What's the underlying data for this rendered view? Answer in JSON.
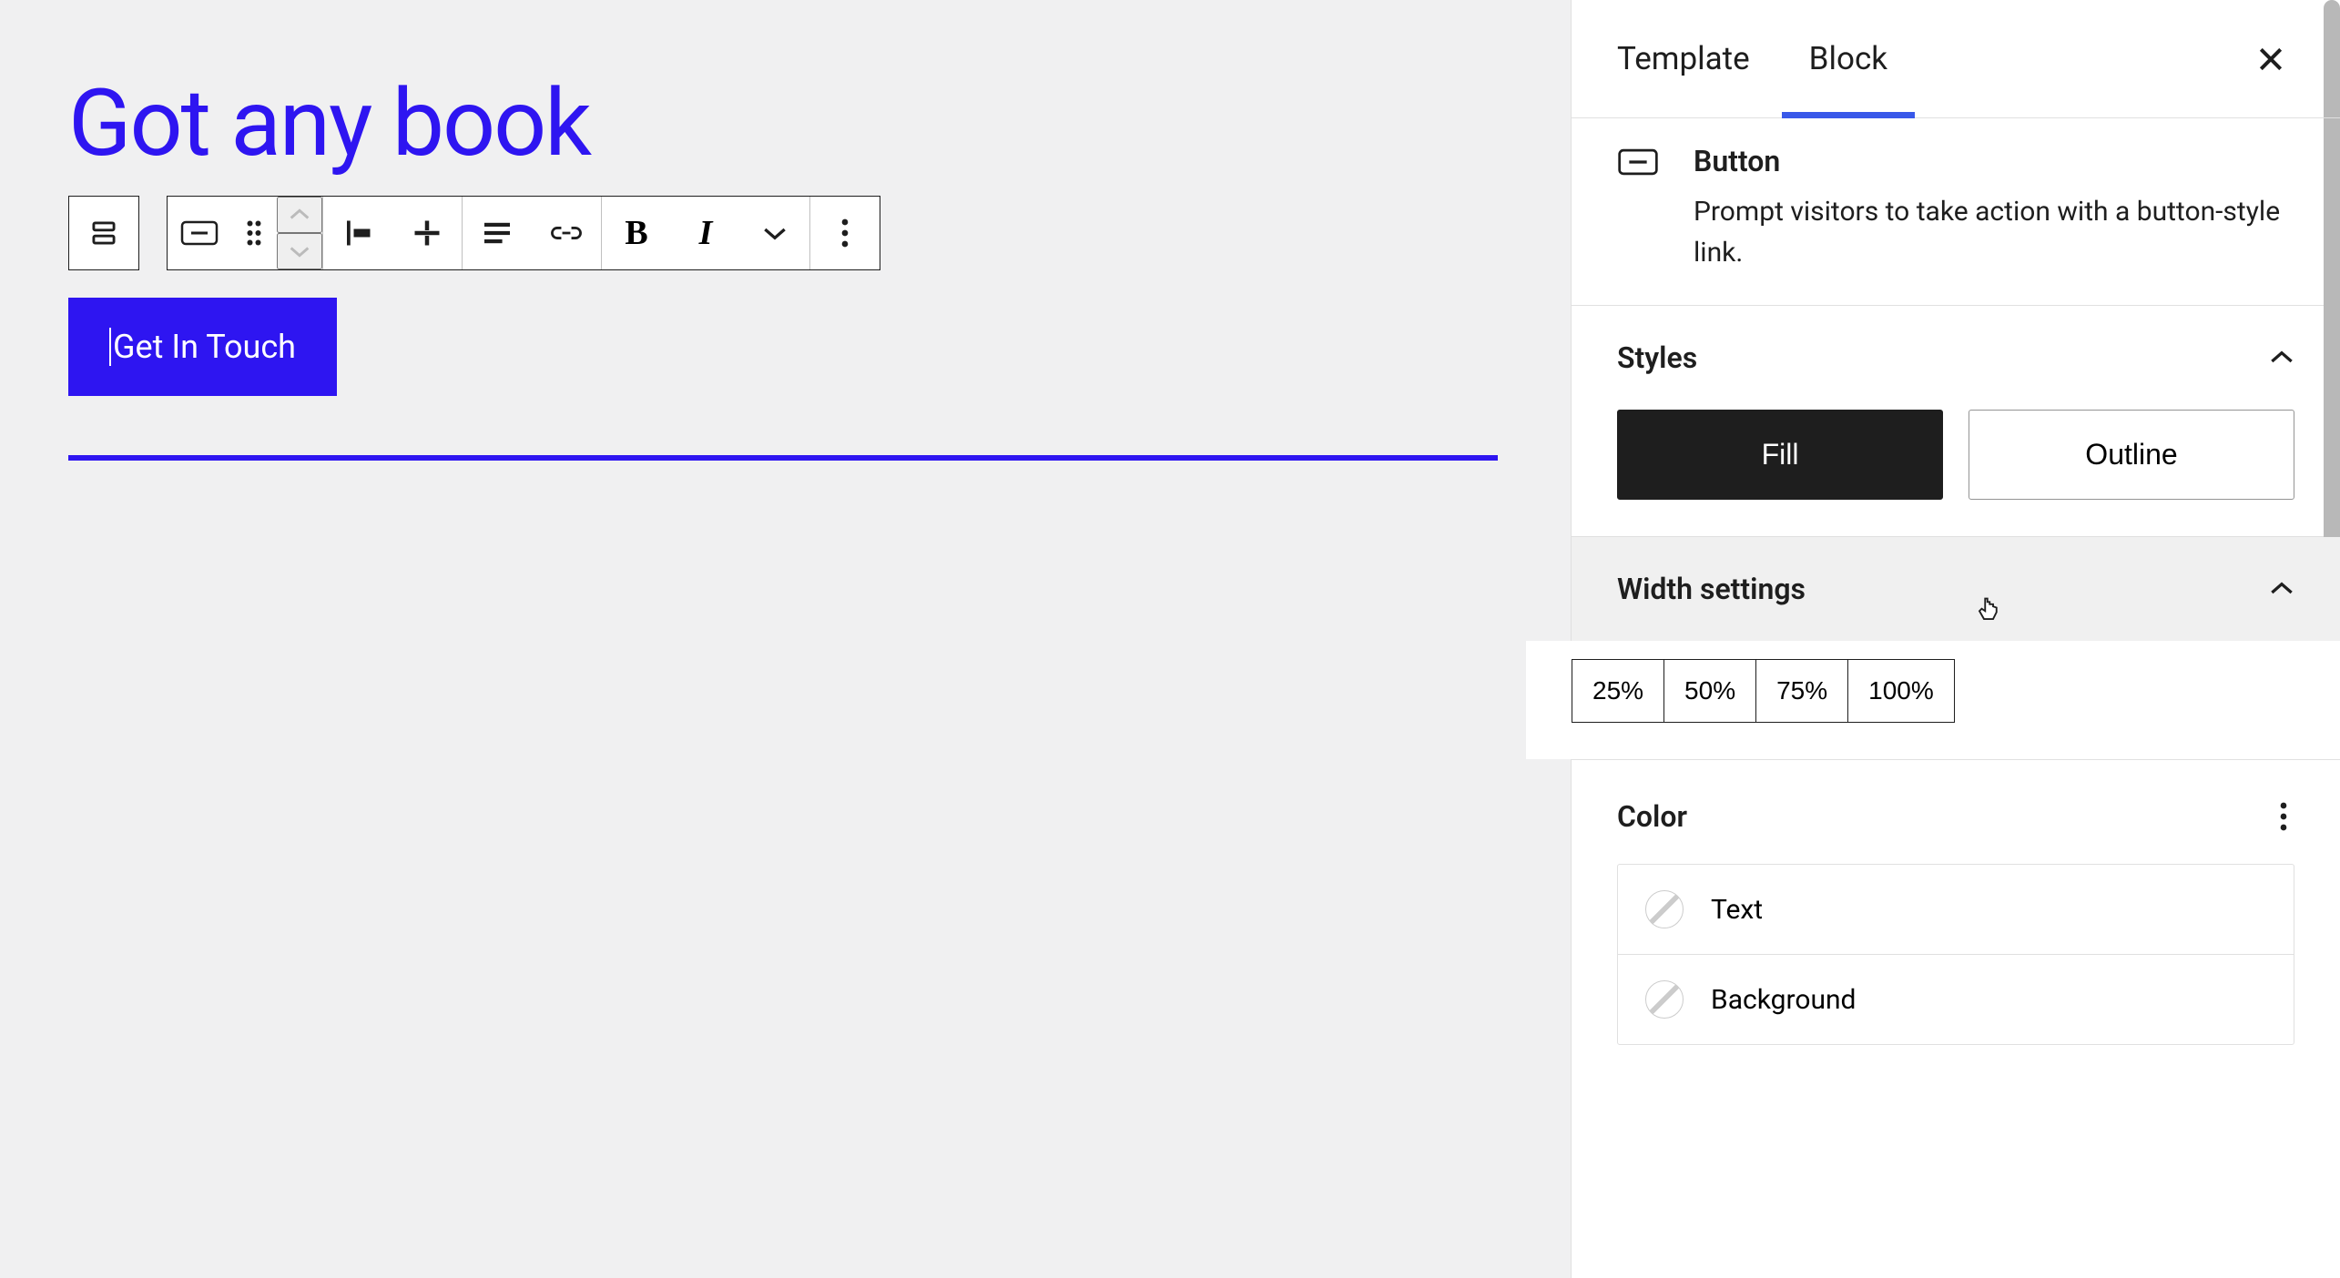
{
  "editor": {
    "heading": "Got any book",
    "button_text": "Get In Touch"
  },
  "sidebar": {
    "tabs": {
      "template": "Template",
      "block": "Block"
    },
    "block": {
      "title": "Button",
      "description": "Prompt visitors to take action with a button-style link."
    },
    "panels": {
      "styles": {
        "title": "Styles",
        "options": {
          "fill": "Fill",
          "outline": "Outline"
        }
      },
      "width": {
        "title": "Width settings",
        "options": [
          "25%",
          "50%",
          "75%",
          "100%"
        ]
      },
      "color": {
        "title": "Color",
        "items": {
          "text": "Text",
          "background": "Background"
        }
      }
    }
  }
}
